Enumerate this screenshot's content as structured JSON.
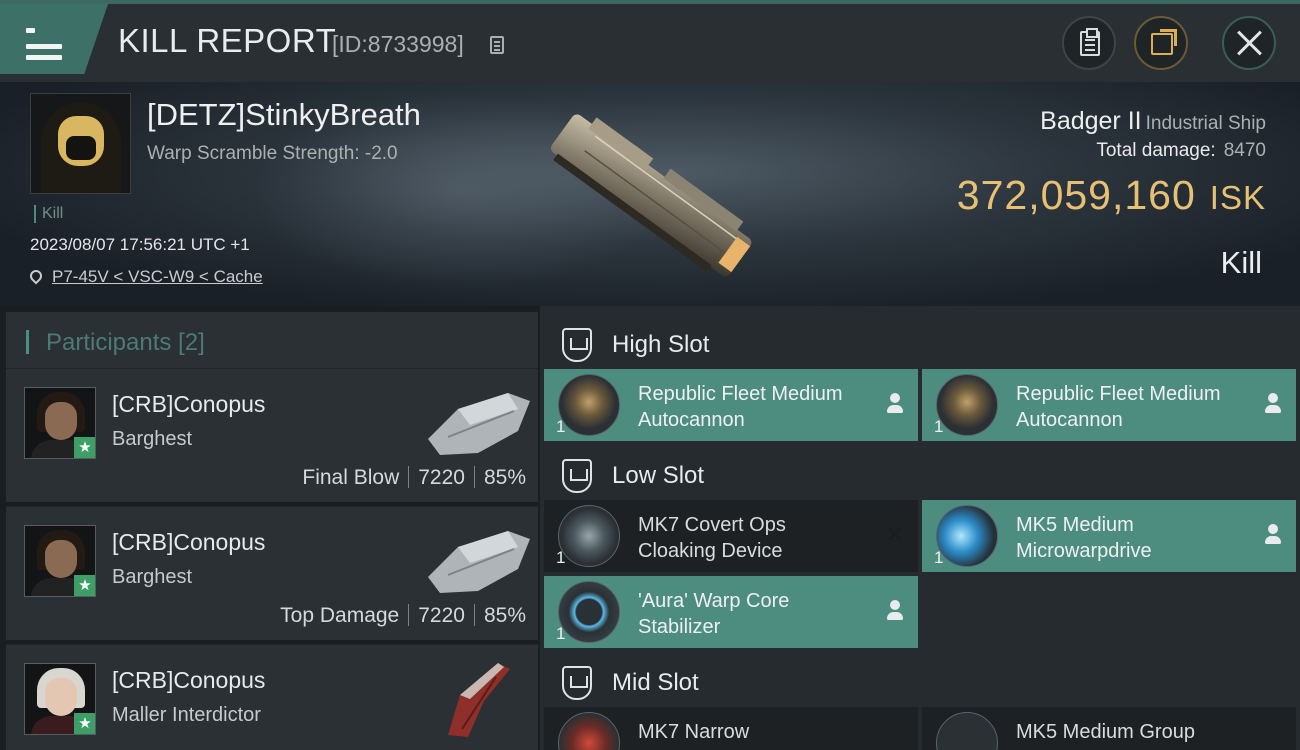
{
  "header": {
    "title": "KILL REPORT",
    "report_id": "[ID:8733998]",
    "icons": [
      "menu-icon",
      "copy-icon",
      "clipboard-icon",
      "share-icon",
      "close-icon"
    ]
  },
  "victim": {
    "pilot": "[DETZ]StinkyBreath",
    "warp_scramble": "Warp Scramble Strength: -2.0",
    "tag": "Kill",
    "datetime": "2023/08/07 17:56:21 UTC +1",
    "location": "P7-45V < VSC-W9 < Cache",
    "ship": "Badger II",
    "ship_class": "Industrial Ship",
    "total_damage_label": "Total damage:",
    "total_damage": "8470",
    "isk_value": "372,059,160",
    "isk_unit": "ISK",
    "result": "Kill"
  },
  "participants": {
    "header": "Participants [2]",
    "items": [
      {
        "name": "[CRB]Conopus",
        "ship": "Barghest",
        "role": "Final Blow",
        "damage": "7220",
        "percent": "85%"
      },
      {
        "name": "[CRB]Conopus",
        "ship": "Barghest",
        "role": "Top Damage",
        "damage": "7220",
        "percent": "85%"
      },
      {
        "name": "[CRB]Conopus",
        "ship": "Maller Interdictor",
        "role": "",
        "damage": "",
        "percent": ""
      }
    ]
  },
  "slots": {
    "high": {
      "title": "High Slot",
      "modules": [
        {
          "qty": "1",
          "name": "Republic Fleet Medium Autocannon"
        },
        {
          "qty": "1",
          "name": "Republic Fleet Medium Autocannon"
        }
      ]
    },
    "low": {
      "title": "Low Slot",
      "modules": [
        {
          "qty": "1",
          "name": "MK7 Covert Ops Cloaking Device"
        },
        {
          "qty": "1",
          "name": "MK5 Medium Microwarpdrive"
        },
        {
          "qty": "1",
          "name": "'Aura' Warp Core Stabilizer"
        }
      ]
    },
    "mid": {
      "title": "Mid Slot",
      "modules": [
        {
          "qty": "",
          "name": "MK7 Narrow"
        },
        {
          "qty": "",
          "name": "MK5 Medium Group"
        }
      ]
    }
  },
  "colors": {
    "accent": "#4d8d80",
    "isk": "#e7c074",
    "panel": "#2a3034",
    "background": "#1b1f22"
  }
}
